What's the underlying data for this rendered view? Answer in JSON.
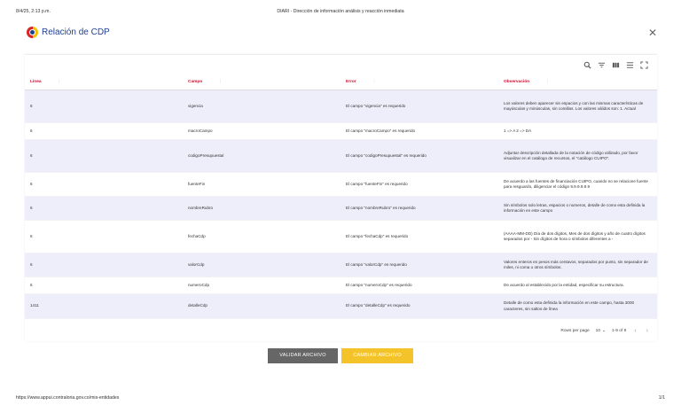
{
  "print_header": {
    "date": "8/4/25, 2:13 p.m.",
    "title": "DIARI - Dirección de información análisis y reacción inmediata"
  },
  "dialog": {
    "title": "Relación de CDP",
    "close_icon": "close-icon"
  },
  "toolbar": {
    "icons": [
      "search-icon",
      "filter-icon",
      "columns-icon",
      "density-icon",
      "fullscreen-icon"
    ]
  },
  "table": {
    "headers": [
      "Línea",
      "Campo",
      "Error",
      "Observación"
    ],
    "rows": [
      {
        "linea": "6",
        "campo": "vigencia",
        "error": "El campo \"vigencia\" es requerido",
        "observacion": "Los valores deben aparecer sin espacios y con las mismas características de mayúsculas y minúsculas, sin comillas. Los valores válidos son: 1. Actual"
      },
      {
        "linea": "6",
        "campo": "macroCampo",
        "error": "El campo \"macroCampo\" es requerido",
        "observacion": "1 => A 2 => DA"
      },
      {
        "linea": "6",
        "campo": "codigoPresupuestal",
        "error": "El campo \"codigoPresupuestal\" es requerido",
        "observacion": "Adjuntar descripción detallada de la notación de código utilizado, por favor visualizar en el catálogo de recursos, el \"catálogo CUIPO\"."
      },
      {
        "linea": "6",
        "campo": "fuenteFin",
        "error": "El campo \"fuenteFin\" es requerido",
        "observacion": "De acuerdo a las fuentes de financiación CUIPO, cuando no se relacione fuente para resguardo, diligenciar el código 9.9.9.9.9.9"
      },
      {
        "linea": "6",
        "campo": "nombreRubro",
        "error": "El campo \"nombreRubro\" es requerido",
        "observacion": "Sin símbolos solo letras, espacios o numeros, detalle de como esta definida la información en este campo"
      },
      {
        "linea": "6",
        "campo": "fechaCdp",
        "error": "El campo \"fechaCdp\" es requerido",
        "observacion": "(AAAA-MM-DD) Día de dos dígitos, Mes de dos dígitos y año de cuatro dígitos separados por - Sin dígitos de hora o símbolos diferentes a -"
      },
      {
        "linea": "6",
        "campo": "valorCdp",
        "error": "El campo \"valorCdp\" es requerido",
        "observacion": "Valores enteros en pesos más centavos, separados por punto, sin separador de miles, ni coma u otros símbolos."
      },
      {
        "linea": "6",
        "campo": "numeroCdp",
        "error": "El campo \"numeroCdp\" es requerido",
        "observacion": "De acuerdo al establecido por la entidad, especificar su estructura."
      },
      {
        "linea": "1411",
        "campo": "detalleCdp",
        "error": "El campo \"detalleCdp\" es requerido",
        "observacion": "Detalle de como esta definida la información en este campo, hasta 3000 caracteres, sin saltos de línea"
      }
    ]
  },
  "pagination": {
    "rows_per_page_label": "Rows per page",
    "rows_per_page_value": "10",
    "range": "1-9 of 9"
  },
  "buttons": {
    "validar": "VALIDAR ARCHIVO",
    "cambiar": "CAMBIAR ARCHIVO"
  },
  "print_footer": {
    "url": "https://www.appui.contraloria.gov.co/mis-entidades",
    "page": "1/1"
  },
  "colors": {
    "header_red": "#c8102e",
    "title_blue": "#1f3f93",
    "row_stripe": "#eeeefa",
    "validar_bg": "#666666",
    "cambiar_bg": "#f4c32a"
  }
}
